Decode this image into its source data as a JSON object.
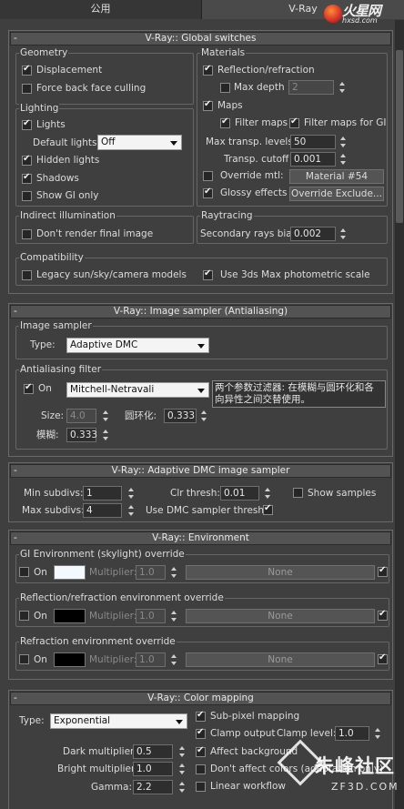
{
  "tabs": [
    "公用",
    "V-Ray"
  ],
  "logo": {
    "brand": "火星网",
    "url": "hxsd.com"
  },
  "watermark": {
    "brand": "朱峰社区",
    "url": "ZF3D.COM"
  },
  "global": {
    "title": "V-Ray:: Global switches",
    "geometry": {
      "label": "Geometry",
      "displacement": "Displacement",
      "force_back": "Force back face culling"
    },
    "lighting": {
      "label": "Lighting",
      "lights": "Lights",
      "default_lights": "Default lights",
      "default_value": "Off",
      "hidden": "Hidden lights",
      "shadows": "Shadows",
      "show_gi": "Show GI only"
    },
    "materials": {
      "label": "Materials",
      "reflection": "Reflection/refraction",
      "max_depth": "Max depth",
      "max_depth_value": "2",
      "maps": "Maps",
      "filter_maps": "Filter maps",
      "filter_gi": "Filter maps for GI",
      "max_transp": "Max transp. levels",
      "max_transp_value": "50",
      "transp_cutoff": "Transp. cutoff",
      "transp_cutoff_value": "0.001",
      "override_mtl": "Override mtl:",
      "override_mtl_btn": "Material #54",
      "glossy": "Glossy effects",
      "override_exclude": "Override Exclude..."
    },
    "indirect": {
      "label": "Indirect illumination",
      "dont_render": "Don't render final image"
    },
    "raytracing": {
      "label": "Raytracing",
      "bias": "Secondary rays bias",
      "bias_value": "0.002"
    },
    "compat": {
      "label": "Compatibility",
      "legacy": "Legacy sun/sky/camera models",
      "photometric": "Use 3ds Max photometric scale"
    }
  },
  "sampler": {
    "title": "V-Ray:: Image sampler (Antialiasing)",
    "group": "Image sampler",
    "type_label": "Type:",
    "type_value": "Adaptive DMC",
    "aa_group": "Antialiasing filter",
    "on": "On",
    "filter_value": "Mitchell-Netravali",
    "note": "两个参数过滤器: 在模糊与圆环化和各向异性之间交替使用。",
    "size_label": "Size:",
    "size_value": "4.0",
    "ring_label": "圆环化:",
    "ring_value": "0.333",
    "blur_label": "模糊:",
    "blur_value": "0.333"
  },
  "dmc": {
    "title": "V-Ray:: Adaptive DMC image sampler",
    "min_label": "Min subdivs:",
    "min_value": "1",
    "max_label": "Max subdivs:",
    "max_value": "4",
    "clr_label": "Clr thresh:",
    "clr_value": "0.01",
    "show_samples": "Show samples",
    "use_dmc": "Use DMC sampler thresh."
  },
  "env": {
    "title": "V-Ray:: Environment",
    "gi": "GI Environment (skylight) override",
    "refl": "Reflection/refraction environment override",
    "refr": "Refraction environment override",
    "on": "On",
    "multiplier": "Multiplier:",
    "mult_value": "1.0",
    "none": "None",
    "colors": {
      "gi": "#f4f8ff",
      "refl": "#000000",
      "refr": "#000000"
    }
  },
  "cmap": {
    "title": "V-Ray:: Color mapping",
    "type_label": "Type:",
    "type_value": "Exponential",
    "dark_label": "Dark multiplier:",
    "dark_value": "0.5",
    "bright_label": "Bright multiplier:",
    "bright_value": "1.0",
    "gamma_label": "Gamma:",
    "gamma_value": "2.2",
    "subpixel": "Sub-pixel mapping",
    "clamp": "Clamp output",
    "clamp_level": "Clamp level:",
    "clamp_value": "1.0",
    "affect_bg": "Affect background",
    "dont_affect": "Don't affect colors (adaptation only)",
    "linear": "Linear workflow"
  }
}
